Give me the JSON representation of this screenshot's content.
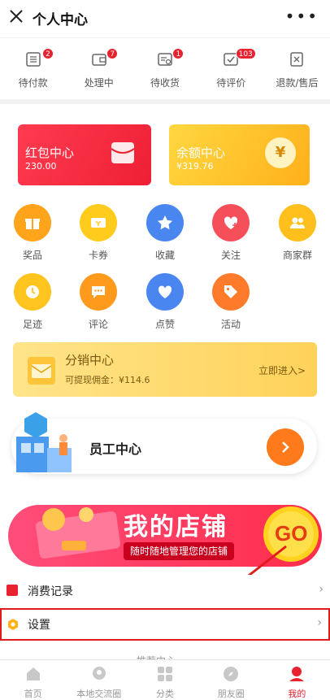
{
  "header": {
    "title": "个人中心",
    "more": "•••"
  },
  "orders": [
    {
      "label": "待付款",
      "badge": "2",
      "icon": "list-icon"
    },
    {
      "label": "处理中",
      "badge": "7",
      "icon": "wallet-icon"
    },
    {
      "label": "待收货",
      "badge": "1",
      "icon": "truck-icon"
    },
    {
      "label": "待评价",
      "badge": "103",
      "icon": "check-icon"
    },
    {
      "label": "退款/售后",
      "badge": "",
      "icon": "refund-icon"
    }
  ],
  "wallet": {
    "red": {
      "title": "红包中心",
      "value": "230.00"
    },
    "balance": {
      "title": "余额中心",
      "value": "¥319.76",
      "coin": "¥"
    }
  },
  "grid": [
    {
      "label": "奖品",
      "icon": "gift-icon"
    },
    {
      "label": "卡券",
      "icon": "coupon-icon"
    },
    {
      "label": "收藏",
      "icon": "star-icon"
    },
    {
      "label": "关注",
      "icon": "heart-plus-icon"
    },
    {
      "label": "商家群",
      "icon": "group-icon"
    },
    {
      "label": "足迹",
      "icon": "clock-icon"
    },
    {
      "label": "评论",
      "icon": "comment-icon"
    },
    {
      "label": "点赞",
      "icon": "heart-icon"
    },
    {
      "label": "活动",
      "icon": "tag-icon"
    }
  ],
  "fenxiao": {
    "title": "分销中心",
    "sub": "可提现佣金：¥114.6",
    "action": "立即进入>"
  },
  "staff": {
    "title": "员工中心"
  },
  "shop": {
    "title": "我的店铺",
    "sub": "随时随地管理您的店铺",
    "go": "GO"
  },
  "rows": {
    "records": "消费记录",
    "settings": "设置",
    "chevron": "›"
  },
  "recommend_peek": "推荐中心",
  "tabs": [
    {
      "label": "首页",
      "icon": "home-icon"
    },
    {
      "label": "本地交流圈",
      "icon": "location-icon"
    },
    {
      "label": "分类",
      "icon": "category-icon"
    },
    {
      "label": "朋友圈",
      "icon": "compass-icon"
    },
    {
      "label": "我的",
      "icon": "user-icon"
    }
  ],
  "colors": {
    "accent": "#e8222e",
    "highlight": "#e01c1c"
  }
}
